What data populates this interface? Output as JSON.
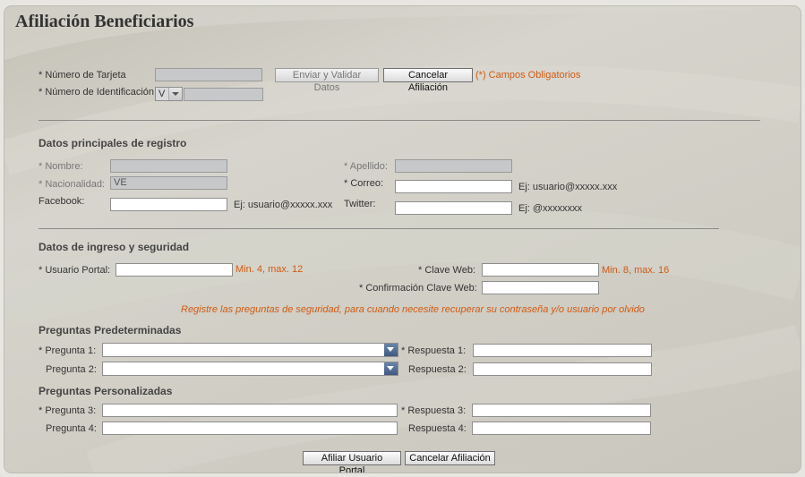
{
  "page": {
    "title": "Afiliación Beneficiarios"
  },
  "top": {
    "card_label": "* Número de Tarjeta",
    "id_label": "* Número de Identificación",
    "id_type_value": "V",
    "send_validate_button": "Enviar y Validar Datos",
    "cancel_button": "Cancelar Afiliación",
    "required_note": "(*) Campos Obligatorios"
  },
  "registro": {
    "heading": "Datos principales de registro",
    "nombre_label": "* Nombre:",
    "apellido_label": "* Apellido:",
    "nacionalidad_label": "* Nacionalidad:",
    "nacionalidad_value": "VE",
    "correo_label": "* Correo:",
    "correo_hint": "Ej: usuario@xxxxx.xxx",
    "facebook_label": "Facebook:",
    "facebook_hint": "Ej: usuario@xxxxx.xxx",
    "twitter_label": "Twitter:",
    "twitter_hint": "Ej: @xxxxxxxx"
  },
  "seguridad": {
    "heading": "Datos de ingreso y seguridad",
    "usuario_label": "* Usuario Portal:",
    "usuario_hint": "Min. 4, max. 12",
    "clave_label": "* Clave Web:",
    "clave_hint": "Min. 8, max. 16",
    "confirm_label": "* Confirmación Clave Web:",
    "notice": "Registre las preguntas de seguridad, para cuando necesite recuperar su contraseña y/o usuario por olvido"
  },
  "predeterminadas": {
    "heading": "Preguntas Predeterminadas",
    "pregunta1_label": "* Pregunta 1:",
    "respuesta1_label": "* Respuesta 1:",
    "pregunta2_label": "Pregunta 2:",
    "respuesta2_label": "Respuesta 2:"
  },
  "personalizadas": {
    "heading": "Preguntas Personalizadas",
    "pregunta3_label": "* Pregunta 3:",
    "respuesta3_label": "* Respuesta 3:",
    "pregunta4_label": "Pregunta 4:",
    "respuesta4_label": "Respuesta 4:"
  },
  "footer": {
    "submit_button": "Afiliar Usuario Portal",
    "cancel_button": "Cancelar Afiliación"
  },
  "colors": {
    "accent_orange": "#d15a12",
    "panel_bg": "#d2d0c8",
    "select_arrow": "#4a6690"
  }
}
